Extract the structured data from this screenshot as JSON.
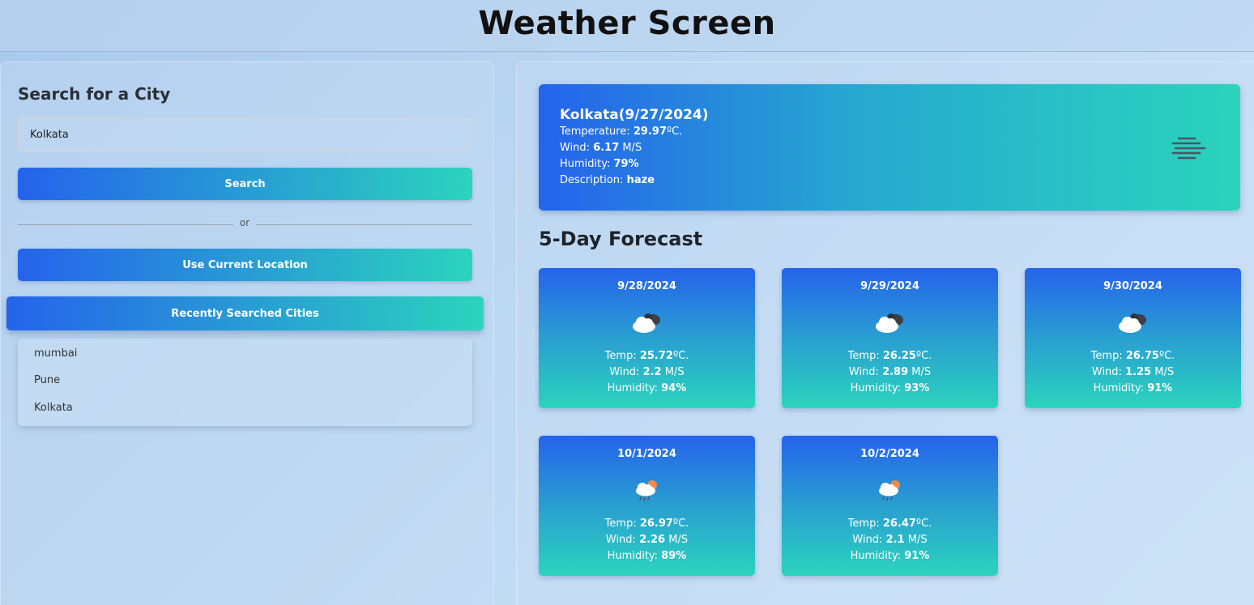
{
  "header": {
    "title": "Weather Screen"
  },
  "search": {
    "title": "Search for a City",
    "input_value": "Kolkata",
    "search_label": "Search",
    "divider_text": "or",
    "location_label": "Use Current Location",
    "recent_label": "Recently Searched Cities",
    "recent_cities": [
      "mumbai",
      "Pune",
      "Kolkata"
    ]
  },
  "current": {
    "city_date": "Kolkata(9/27/2024)",
    "temperature_label": "Temperature: ",
    "temperature_value": "29.97",
    "temperature_unit": "ºC.",
    "wind_label": "Wind: ",
    "wind_value": "6.17",
    "wind_unit": " M/S",
    "humidity_label": "Humidity: ",
    "humidity_value": "79%",
    "description_label": "Description: ",
    "description_value": "haze",
    "icon": "haze-icon"
  },
  "forecast": {
    "title": "5-Day Forecast",
    "temp_label": "Temp: ",
    "temp_unit": "ºC.",
    "wind_label": "Wind: ",
    "wind_unit": " M/S",
    "humidity_label": "Humidity: ",
    "days": [
      {
        "date": "9/28/2024",
        "temp": "25.72",
        "wind": "2.2",
        "humidity": "94%",
        "icon": "broken-clouds-icon"
      },
      {
        "date": "9/29/2024",
        "temp": "26.25",
        "wind": "2.89",
        "humidity": "93%",
        "icon": "broken-clouds-icon"
      },
      {
        "date": "9/30/2024",
        "temp": "26.75",
        "wind": "1.25",
        "humidity": "91%",
        "icon": "broken-clouds-icon"
      },
      {
        "date": "10/1/2024",
        "temp": "26.97",
        "wind": "2.26",
        "humidity": "89%",
        "icon": "rain-icon"
      },
      {
        "date": "10/2/2024",
        "temp": "26.47",
        "wind": "2.1",
        "humidity": "91%",
        "icon": "rain-icon"
      }
    ]
  }
}
